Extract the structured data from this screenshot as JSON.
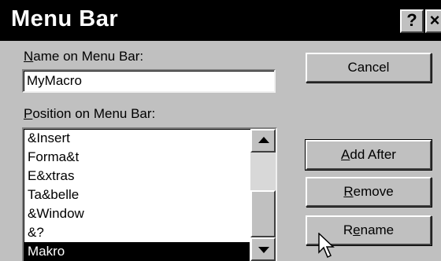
{
  "window": {
    "title": "Menu Bar",
    "help_label": "?",
    "close_label": "×"
  },
  "name_field": {
    "label_mnemonic": "N",
    "label_rest": "ame on Menu Bar:",
    "value": "MyMacro"
  },
  "position_list": {
    "label_mnemonic": "P",
    "label_rest": "osition on Menu Bar:",
    "items": [
      "&Insert",
      "Forma&t",
      "E&xtras",
      "Ta&belle",
      "&Window",
      "&?",
      "Makro"
    ],
    "selected_index": 6
  },
  "buttons": {
    "cancel": "Cancel",
    "add_after_mnemonic": "A",
    "add_after_rest": "dd After",
    "remove_mnemonic": "R",
    "remove_rest": "emove",
    "rename_pre": "R",
    "rename_mnemonic": "e",
    "rename_rest": "name"
  }
}
